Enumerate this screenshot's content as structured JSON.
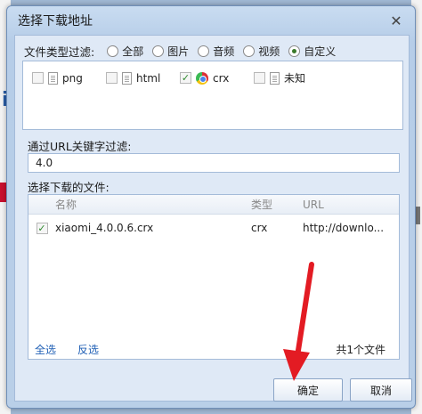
{
  "dialog": {
    "title": "选择下载地址",
    "close_icon": "close-icon"
  },
  "type_filter": {
    "label": "文件类型过滤:",
    "options": [
      {
        "label": "全部",
        "selected": false
      },
      {
        "label": "图片",
        "selected": false
      },
      {
        "label": "音频",
        "selected": false
      },
      {
        "label": "视频",
        "selected": false
      },
      {
        "label": "自定义",
        "selected": true
      }
    ],
    "types": [
      {
        "label": "png",
        "checked": false,
        "icon": "file-icon"
      },
      {
        "label": "html",
        "checked": false,
        "icon": "file-icon"
      },
      {
        "label": "crx",
        "checked": true,
        "icon": "chrome-icon"
      },
      {
        "label": "未知",
        "checked": false,
        "icon": "file-icon"
      }
    ]
  },
  "url_filter": {
    "label": "通过URL关键字过滤:",
    "value": "4.0"
  },
  "files": {
    "label": "选择下载的文件:",
    "columns": [
      "名称",
      "类型",
      "URL"
    ],
    "rows": [
      {
        "checked": true,
        "name": "xiaomi_4.0.0.6.crx",
        "type": "crx",
        "url": "http://downlo..."
      }
    ],
    "select_all": "全选",
    "invert": "反选",
    "count_text": "共1个文件"
  },
  "buttons": {
    "ok": "确定",
    "cancel": "取消"
  },
  "colors": {
    "link": "#1f5fb5",
    "check": "#2f8a2f",
    "arrow": "#e31b23"
  }
}
